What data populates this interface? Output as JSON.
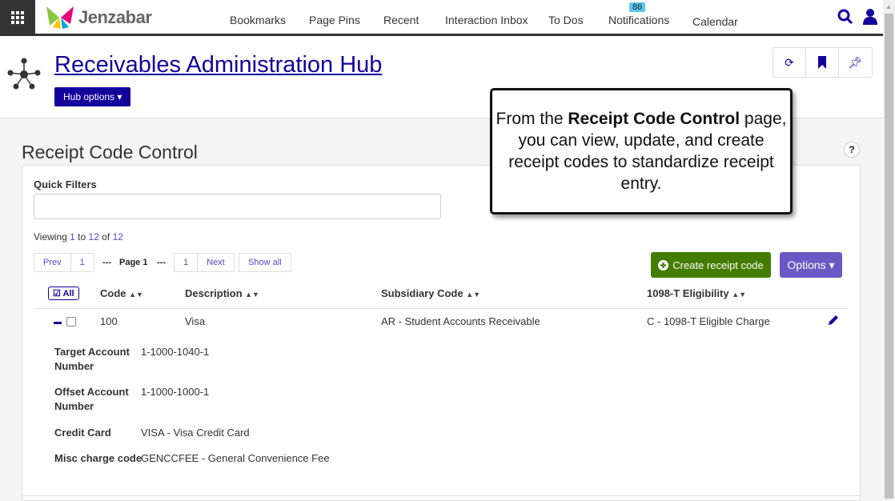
{
  "topbar": {
    "brand": "Jenzabar",
    "nav": [
      "Bookmarks",
      "Page Pins",
      "Recent",
      "Interaction Inbox",
      "To Dos",
      "Notifications",
      "Calendar"
    ],
    "notification_count": "86"
  },
  "hub": {
    "title": "Receivables Administration Hub",
    "options_label": "Hub options"
  },
  "page": {
    "title": "Receipt Code Control",
    "help": "?"
  },
  "filters": {
    "label": "Quick Filters",
    "value": "",
    "placeholder": ""
  },
  "paging": {
    "viewing_prefix": "Viewing ",
    "from": "1",
    "to_word": " to ",
    "to": "12",
    "of_word": " of ",
    "total": "12",
    "prev": "Prev",
    "first": "1",
    "sep": "---",
    "current": "Page 1",
    "last": "1",
    "next": "Next",
    "show_all": "Show all"
  },
  "actions": {
    "create": "Create receipt code",
    "options": "Options"
  },
  "table": {
    "select_all": "All",
    "headers": [
      "Code",
      "Description",
      "Subsidiary Code",
      "1098-T Eligibility"
    ],
    "rows": [
      {
        "code": "100",
        "description": "Visa",
        "subsidiary": "AR - Student Accounts Receivable",
        "eligibility": "C - 1098-T Eligible Charge",
        "details": [
          {
            "label": "Target Account Number",
            "value": "1-1000-1040-1"
          },
          {
            "label": "Offset Account Number",
            "value": "1-1000-1000-1"
          },
          {
            "label": "Credit Card",
            "value": "VISA - Visa Credit Card"
          },
          {
            "label": "Misc charge code",
            "value": "GENCCFEE - General Convenience Fee"
          }
        ]
      }
    ]
  },
  "callout": {
    "pre": "From the ",
    "bold": "Receipt Code Control",
    "post": " page, you can view, update, and create receipt codes to standardize receipt entry."
  }
}
